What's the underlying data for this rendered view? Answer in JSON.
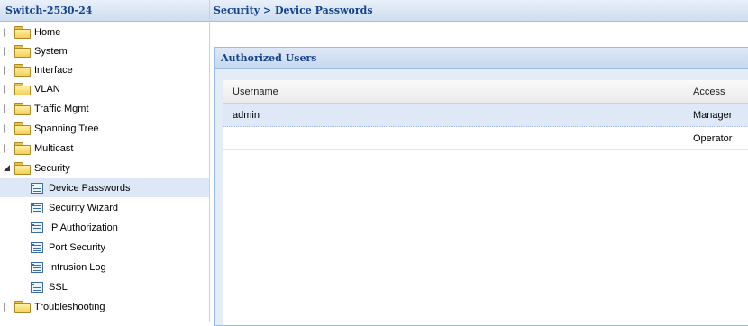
{
  "nav": {
    "title": "Switch-2530-24",
    "items": [
      {
        "label": "Home",
        "kind": "folder",
        "state": "collapsed"
      },
      {
        "label": "System",
        "kind": "folder",
        "state": "collapsed"
      },
      {
        "label": "Interface",
        "kind": "folder",
        "state": "collapsed"
      },
      {
        "label": "VLAN",
        "kind": "folder",
        "state": "collapsed"
      },
      {
        "label": "Traffic Mgmt",
        "kind": "folder",
        "state": "collapsed"
      },
      {
        "label": "Spanning Tree",
        "kind": "folder",
        "state": "collapsed"
      },
      {
        "label": "Multicast",
        "kind": "folder",
        "state": "collapsed"
      },
      {
        "label": "Security",
        "kind": "folder",
        "state": "expanded"
      },
      {
        "label": "Device Passwords",
        "kind": "page",
        "selected": true
      },
      {
        "label": "Security Wizard",
        "kind": "page"
      },
      {
        "label": "IP Authorization",
        "kind": "page"
      },
      {
        "label": "Port Security",
        "kind": "page"
      },
      {
        "label": "Intrusion Log",
        "kind": "page"
      },
      {
        "label": "SSL",
        "kind": "page"
      },
      {
        "label": "Troubleshooting",
        "kind": "folder",
        "state": "collapsed"
      }
    ]
  },
  "breadcrumb": "Security > Device Passwords",
  "panel": {
    "title": "Authorized Users",
    "columns": {
      "username": "Username",
      "access": "Access"
    },
    "rows": [
      {
        "username": "admin",
        "access": "Manager",
        "selected": true
      },
      {
        "username": "",
        "access": "Operator",
        "selected": false
      }
    ]
  },
  "colors": {
    "header_text": "#15428b",
    "selected_row": "#dfe8f6",
    "panel_border": "#99bbe8"
  }
}
